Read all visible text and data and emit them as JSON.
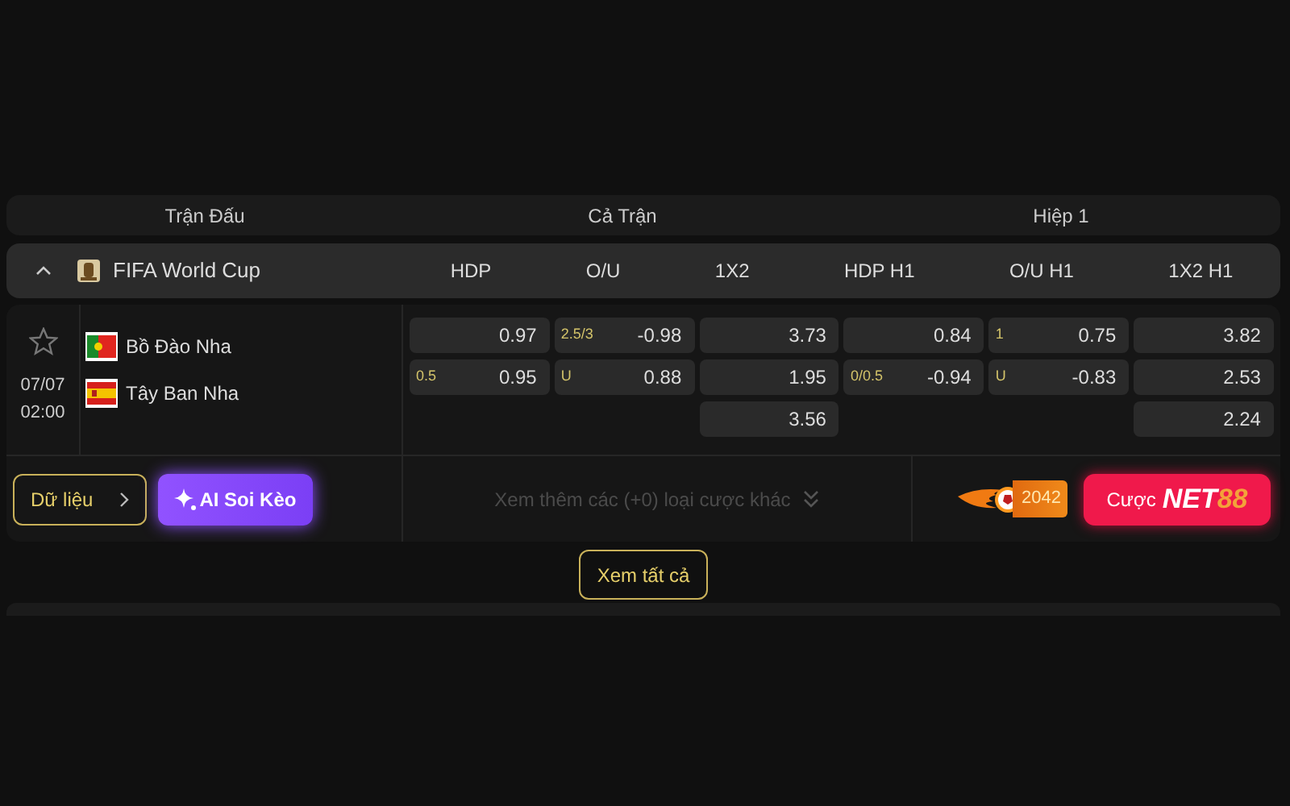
{
  "header": {
    "match_label": "Trận Đấu",
    "groups": [
      {
        "label": "Cả Trận"
      },
      {
        "label": "Hiệp 1"
      }
    ]
  },
  "league": {
    "name": "FIFA World Cup",
    "expanded": true,
    "columns": [
      "HDP",
      "O/U",
      "1X2",
      "HDP H1",
      "O/U H1",
      "1X2 H1"
    ]
  },
  "match": {
    "starred": false,
    "date": "07/07",
    "time": "02:00",
    "teams": [
      {
        "name": "Bồ Đào Nha"
      },
      {
        "name": "Tây Ban Nha"
      }
    ],
    "markets": [
      [
        {
          "value": "0.97"
        },
        {
          "line": "0.5",
          "value": "0.95"
        }
      ],
      [
        {
          "line": "2.5/3",
          "value": "-0.98"
        },
        {
          "line": "U",
          "value": "0.88"
        }
      ],
      [
        {
          "value": "3.73"
        },
        {
          "value": "1.95"
        },
        {
          "value": "3.56"
        }
      ],
      [
        {
          "value": "0.84"
        },
        {
          "line": "0/0.5",
          "value": "-0.94"
        }
      ],
      [
        {
          "line": "1",
          "value": "0.75"
        },
        {
          "line": "U",
          "value": "-0.83"
        }
      ],
      [
        {
          "value": "3.82"
        },
        {
          "value": "2.53"
        },
        {
          "value": "2.24"
        }
      ]
    ]
  },
  "footer": {
    "stats_button": "Dữ liệu",
    "ai_button": "AI Soi Kèo",
    "more_text": "Xem thêm các (+0) loại cược khác",
    "hot_count": "2042",
    "bet_button": {
      "prefix": "Cược",
      "brand_main": "NET",
      "brand_accent": "88"
    }
  },
  "view_all_button": "Xem tất cả"
}
